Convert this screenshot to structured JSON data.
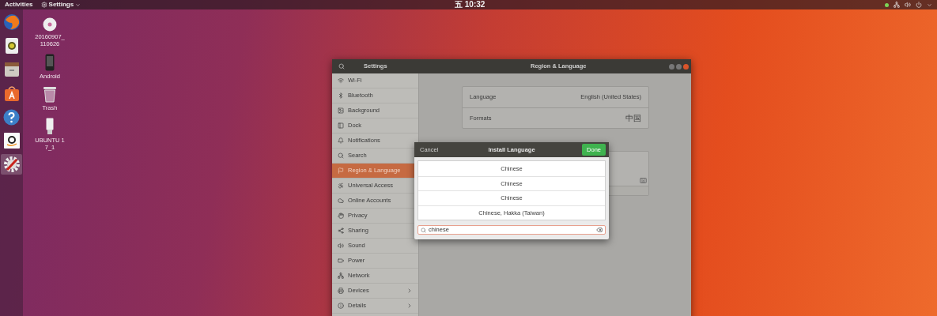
{
  "top_bar": {
    "activities": "Activities",
    "app_menu": "Settings",
    "clock": "五 10:32"
  },
  "dock": [
    {
      "kind": "browser",
      "selected": false
    },
    {
      "kind": "speaker",
      "selected": false
    },
    {
      "kind": "files",
      "selected": false
    },
    {
      "kind": "store",
      "selected": false
    },
    {
      "kind": "help",
      "selected": false
    },
    {
      "kind": "shop",
      "selected": false
    },
    {
      "kind": "settings",
      "selected": true
    }
  ],
  "desktop_icons": [
    {
      "kind": "disc",
      "label": "20160907_110626"
    },
    {
      "kind": "phone",
      "label": "Android"
    },
    {
      "kind": "trash",
      "label": "Trash"
    },
    {
      "kind": "usb",
      "label": "UBUNTU 17_1"
    }
  ],
  "settings_window": {
    "sidebar_title": "Settings",
    "title": "Region & Language",
    "sidebar": [
      {
        "kind": "wifi",
        "label": "Wi-Fi",
        "selected": false,
        "arrow": false
      },
      {
        "kind": "bluetooth",
        "label": "Bluetooth",
        "selected": false,
        "arrow": false
      },
      {
        "kind": "background",
        "label": "Background",
        "selected": false,
        "arrow": false
      },
      {
        "kind": "dock",
        "label": "Dock",
        "selected": false,
        "arrow": false
      },
      {
        "kind": "notifications",
        "label": "Notifications",
        "selected": false,
        "arrow": false
      },
      {
        "kind": "search",
        "label": "Search",
        "selected": false,
        "arrow": false
      },
      {
        "kind": "region",
        "label": "Region & Language",
        "selected": true,
        "arrow": false
      },
      {
        "kind": "access",
        "label": "Universal Access",
        "selected": false,
        "arrow": false
      },
      {
        "kind": "accounts",
        "label": "Online Accounts",
        "selected": false,
        "arrow": false
      },
      {
        "kind": "privacy",
        "label": "Privacy",
        "selected": false,
        "arrow": false
      },
      {
        "kind": "sharing",
        "label": "Sharing",
        "selected": false,
        "arrow": false
      },
      {
        "kind": "sound",
        "label": "Sound",
        "selected": false,
        "arrow": false
      },
      {
        "kind": "power",
        "label": "Power",
        "selected": false,
        "arrow": false
      },
      {
        "kind": "network",
        "label": "Network",
        "selected": false,
        "arrow": false
      },
      {
        "kind": "devices",
        "label": "Devices",
        "selected": false,
        "arrow": true
      },
      {
        "kind": "details",
        "label": "Details",
        "selected": false,
        "arrow": true
      }
    ],
    "language_panel": [
      {
        "label": "Language",
        "value": "English (United States)"
      },
      {
        "label": "Formats",
        "value": "中国"
      }
    ]
  },
  "dialog": {
    "cancel": "Cancel",
    "title": "Install Language",
    "done": "Done",
    "results": [
      "Chinese",
      "Chinese",
      "Chinese",
      "Chinese, Hakka (Taiwan)"
    ],
    "search": {
      "value": "chinese"
    }
  }
}
